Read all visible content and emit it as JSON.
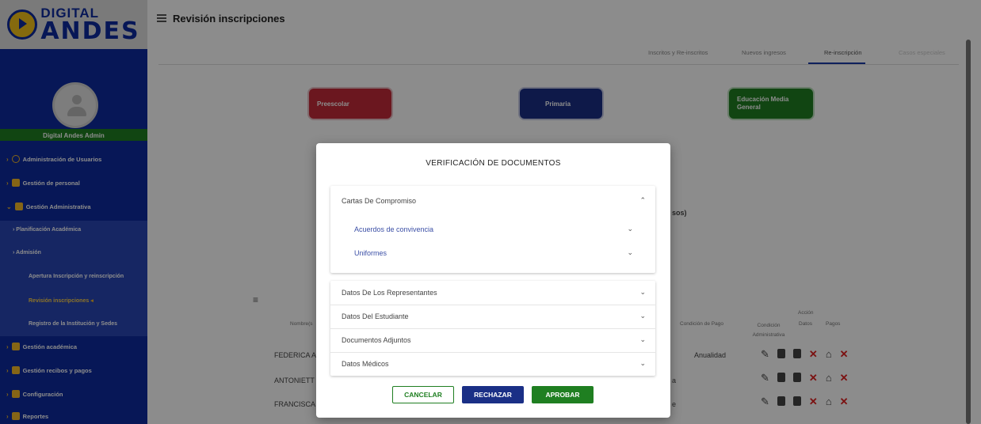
{
  "logo": {
    "line1": "DIGITAL",
    "line2": "ANDES"
  },
  "header": {
    "title": "Revisión inscripciones"
  },
  "tabs": [
    {
      "label": "Inscritos y Re-inscritos"
    },
    {
      "label": "Nuevos ingresos"
    },
    {
      "label": "Re-inscripción"
    },
    {
      "label": "Casos especiales"
    }
  ],
  "levels": {
    "preescolar": "Preescolar",
    "primaria": "Primaria",
    "media": "Educación Media General"
  },
  "user": {
    "name": "Digital Andes Admin"
  },
  "sidebar": {
    "items": [
      {
        "label": "Administración de Usuarios"
      },
      {
        "label": "Gestión de personal"
      },
      {
        "label": "Gestión Administrativa"
      },
      {
        "label": "Gestión académica"
      },
      {
        "label": "Gestión recibos y pagos"
      },
      {
        "label": "Configuración"
      },
      {
        "label": "Reportes"
      }
    ],
    "sub": [
      {
        "label": "Planificación Académica"
      },
      {
        "label": "Admisión"
      },
      {
        "label": "Apertura Inscripción y reinscripción"
      },
      {
        "label": "Revisión inscripciones"
      },
      {
        "label": "Registro de la Institución y Sedes"
      }
    ]
  },
  "table": {
    "fragment": "sos)",
    "headers": {
      "name": "Nombre(s",
      "condicion_pago": "Condición de Pago",
      "condicion_admin": "Condición Administrativa",
      "datos": "Datos",
      "pagos": "Pagos",
      "accion": "Acción"
    },
    "rows": [
      {
        "name": "FEDERICA A",
        "pago": "Anualidad"
      },
      {
        "name": "ANTONIETT",
        "pago": "a"
      },
      {
        "name": "FRANCISCA",
        "pago": "e"
      }
    ]
  },
  "modal": {
    "title": "VERIFICACIÓN DE DOCUMENTOS",
    "sections": [
      {
        "label": "Cartas De Compromiso"
      },
      {
        "label": "Acuerdos de convivencia"
      },
      {
        "label": "Uniformes"
      },
      {
        "label": "Datos De Los Representantes"
      },
      {
        "label": "Datos Del Estudiante"
      },
      {
        "label": "Documentos Adjuntos"
      },
      {
        "label": "Datos Médicos"
      }
    ],
    "buttons": {
      "cancel": "CANCELAR",
      "reject": "RECHAZAR",
      "approve": "APROBAR"
    }
  },
  "colors": {
    "sidebar": "#0d2a9e",
    "green": "#1f7f21",
    "red_btn": "#c42a3a",
    "blue_btn": "#1a2f86",
    "yellow": "#f2b829"
  }
}
